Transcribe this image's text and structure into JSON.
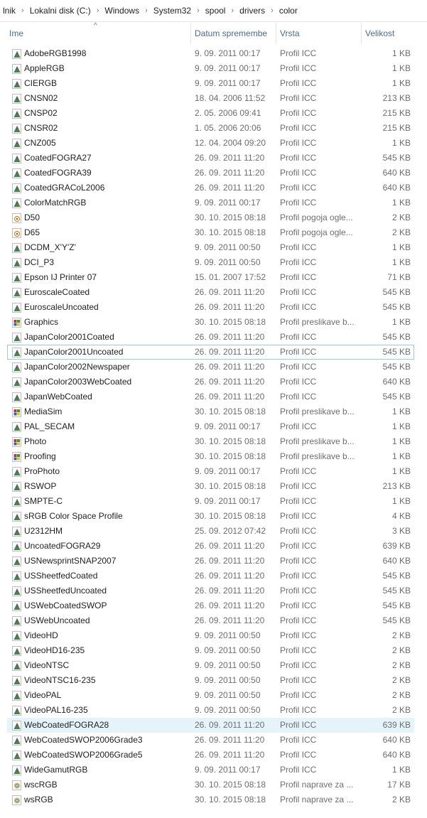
{
  "breadcrumb": [
    "lnik",
    "Lokalni disk (C:)",
    "Windows",
    "System32",
    "spool",
    "drivers",
    "color"
  ],
  "breadcrumb_separator": "›",
  "columns": {
    "name": "Ime",
    "date": "Datum spremembe",
    "type": "Vrsta",
    "size": "Velikost"
  },
  "sort_indicator": "^",
  "files": [
    {
      "name": "AdobeRGB1998",
      "date": "9. 09. 2011 00:17",
      "type": "Profil ICC",
      "size": "1 KB",
      "icon": "icc-profile-icon"
    },
    {
      "name": "AppleRGB",
      "date": "9. 09. 2011 00:17",
      "type": "Profil ICC",
      "size": "1 KB",
      "icon": "icc-profile-icon"
    },
    {
      "name": "CIERGB",
      "date": "9. 09. 2011 00:17",
      "type": "Profil ICC",
      "size": "1 KB",
      "icon": "icc-profile-icon"
    },
    {
      "name": "CNSN02",
      "date": "18. 04. 2006 11:52",
      "type": "Profil ICC",
      "size": "213 KB",
      "icon": "icc-profile-icon"
    },
    {
      "name": "CNSP02",
      "date": "2. 05. 2006 09:41",
      "type": "Profil ICC",
      "size": "215 KB",
      "icon": "icc-profile-icon"
    },
    {
      "name": "CNSR02",
      "date": "1. 05. 2006 20:06",
      "type": "Profil ICC",
      "size": "215 KB",
      "icon": "icc-profile-icon"
    },
    {
      "name": "CNZ005",
      "date": "12. 04. 2004 09:20",
      "type": "Profil ICC",
      "size": "1 KB",
      "icon": "icc-profile-icon"
    },
    {
      "name": "CoatedFOGRA27",
      "date": "26. 09. 2011 11:20",
      "type": "Profil ICC",
      "size": "545 KB",
      "icon": "icc-profile-icon"
    },
    {
      "name": "CoatedFOGRA39",
      "date": "26. 09. 2011 11:20",
      "type": "Profil ICC",
      "size": "640 KB",
      "icon": "icc-profile-icon"
    },
    {
      "name": "CoatedGRACoL2006",
      "date": "26. 09. 2011 11:20",
      "type": "Profil ICC",
      "size": "640 KB",
      "icon": "icc-profile-icon"
    },
    {
      "name": "ColorMatchRGB",
      "date": "9. 09. 2011 00:17",
      "type": "Profil ICC",
      "size": "1 KB",
      "icon": "icc-profile-icon"
    },
    {
      "name": "D50",
      "date": "30. 10. 2015 08:18",
      "type": "Profil pogoja ogle...",
      "size": "2 KB",
      "icon": "viewing-condition-icon"
    },
    {
      "name": "D65",
      "date": "30. 10. 2015 08:18",
      "type": "Profil pogoja ogle...",
      "size": "2 KB",
      "icon": "viewing-condition-icon"
    },
    {
      "name": "DCDM_X'Y'Z'",
      "date": "9. 09. 2011 00:50",
      "type": "Profil ICC",
      "size": "1 KB",
      "icon": "icc-profile-icon"
    },
    {
      "name": "DCI_P3",
      "date": "9. 09. 2011 00:50",
      "type": "Profil ICC",
      "size": "1 KB",
      "icon": "icc-profile-icon"
    },
    {
      "name": "Epson IJ Printer 07",
      "date": "15. 01. 2007 17:52",
      "type": "Profil ICC",
      "size": "71 KB",
      "icon": "icc-profile-icon"
    },
    {
      "name": "EuroscaleCoated",
      "date": "26. 09. 2011 11:20",
      "type": "Profil ICC",
      "size": "545 KB",
      "icon": "icc-profile-icon"
    },
    {
      "name": "EuroscaleUncoated",
      "date": "26. 09. 2011 11:20",
      "type": "Profil ICC",
      "size": "545 KB",
      "icon": "icc-profile-icon"
    },
    {
      "name": "Graphics",
      "date": "30. 10. 2015 08:18",
      "type": "Profil preslikave b...",
      "size": "1 KB",
      "icon": "gamut-map-icon"
    },
    {
      "name": "JapanColor2001Coated",
      "date": "26. 09. 2011 11:20",
      "type": "Profil ICC",
      "size": "545 KB",
      "icon": "icc-profile-icon"
    },
    {
      "name": "JapanColor2001Uncoated",
      "date": "26. 09. 2011 11:20",
      "type": "Profil ICC",
      "size": "545 KB",
      "icon": "icc-profile-icon"
    },
    {
      "name": "JapanColor2002Newspaper",
      "date": "26. 09. 2011 11:20",
      "type": "Profil ICC",
      "size": "545 KB",
      "icon": "icc-profile-icon"
    },
    {
      "name": "JapanColor2003WebCoated",
      "date": "26. 09. 2011 11:20",
      "type": "Profil ICC",
      "size": "640 KB",
      "icon": "icc-profile-icon"
    },
    {
      "name": "JapanWebCoated",
      "date": "26. 09. 2011 11:20",
      "type": "Profil ICC",
      "size": "545 KB",
      "icon": "icc-profile-icon"
    },
    {
      "name": "MediaSim",
      "date": "30. 10. 2015 08:18",
      "type": "Profil preslikave b...",
      "size": "1 KB",
      "icon": "gamut-map-icon"
    },
    {
      "name": "PAL_SECAM",
      "date": "9. 09. 2011 00:17",
      "type": "Profil ICC",
      "size": "1 KB",
      "icon": "icc-profile-icon"
    },
    {
      "name": "Photo",
      "date": "30. 10. 2015 08:18",
      "type": "Profil preslikave b...",
      "size": "1 KB",
      "icon": "gamut-map-icon"
    },
    {
      "name": "Proofing",
      "date": "30. 10. 2015 08:18",
      "type": "Profil preslikave b...",
      "size": "1 KB",
      "icon": "gamut-map-icon"
    },
    {
      "name": "ProPhoto",
      "date": "9. 09. 2011 00:17",
      "type": "Profil ICC",
      "size": "1 KB",
      "icon": "icc-profile-icon"
    },
    {
      "name": "RSWOP",
      "date": "30. 10. 2015 08:18",
      "type": "Profil ICC",
      "size": "213 KB",
      "icon": "icc-profile-icon"
    },
    {
      "name": "SMPTE-C",
      "date": "9. 09. 2011 00:17",
      "type": "Profil ICC",
      "size": "1 KB",
      "icon": "icc-profile-icon"
    },
    {
      "name": "sRGB Color Space Profile",
      "date": "30. 10. 2015 08:18",
      "type": "Profil ICC",
      "size": "4 KB",
      "icon": "icc-profile-icon"
    },
    {
      "name": "U2312HM",
      "date": "25. 09. 2012 07:42",
      "type": "Profil ICC",
      "size": "3 KB",
      "icon": "icc-profile-icon"
    },
    {
      "name": "UncoatedFOGRA29",
      "date": "26. 09. 2011 11:20",
      "type": "Profil ICC",
      "size": "639 KB",
      "icon": "icc-profile-icon"
    },
    {
      "name": "USNewsprintSNAP2007",
      "date": "26. 09. 2011 11:20",
      "type": "Profil ICC",
      "size": "640 KB",
      "icon": "icc-profile-icon"
    },
    {
      "name": "USSheetfedCoated",
      "date": "26. 09. 2011 11:20",
      "type": "Profil ICC",
      "size": "545 KB",
      "icon": "icc-profile-icon"
    },
    {
      "name": "USSheetfedUncoated",
      "date": "26. 09. 2011 11:20",
      "type": "Profil ICC",
      "size": "545 KB",
      "icon": "icc-profile-icon"
    },
    {
      "name": "USWebCoatedSWOP",
      "date": "26. 09. 2011 11:20",
      "type": "Profil ICC",
      "size": "545 KB",
      "icon": "icc-profile-icon"
    },
    {
      "name": "USWebUncoated",
      "date": "26. 09. 2011 11:20",
      "type": "Profil ICC",
      "size": "545 KB",
      "icon": "icc-profile-icon"
    },
    {
      "name": "VideoHD",
      "date": "9. 09. 2011 00:50",
      "type": "Profil ICC",
      "size": "2 KB",
      "icon": "icc-profile-icon"
    },
    {
      "name": "VideoHD16-235",
      "date": "9. 09. 2011 00:50",
      "type": "Profil ICC",
      "size": "2 KB",
      "icon": "icc-profile-icon"
    },
    {
      "name": "VideoNTSC",
      "date": "9. 09. 2011 00:50",
      "type": "Profil ICC",
      "size": "2 KB",
      "icon": "icc-profile-icon"
    },
    {
      "name": "VideoNTSC16-235",
      "date": "9. 09. 2011 00:50",
      "type": "Profil ICC",
      "size": "2 KB",
      "icon": "icc-profile-icon"
    },
    {
      "name": "VideoPAL",
      "date": "9. 09. 2011 00:50",
      "type": "Profil ICC",
      "size": "2 KB",
      "icon": "icc-profile-icon"
    },
    {
      "name": "VideoPAL16-235",
      "date": "9. 09. 2011 00:50",
      "type": "Profil ICC",
      "size": "2 KB",
      "icon": "icc-profile-icon"
    },
    {
      "name": "WebCoatedFOGRA28",
      "date": "26. 09. 2011 11:20",
      "type": "Profil ICC",
      "size": "639 KB",
      "icon": "icc-profile-icon"
    },
    {
      "name": "WebCoatedSWOP2006Grade3",
      "date": "26. 09. 2011 11:20",
      "type": "Profil ICC",
      "size": "640 KB",
      "icon": "icc-profile-icon"
    },
    {
      "name": "WebCoatedSWOP2006Grade5",
      "date": "26. 09. 2011 11:20",
      "type": "Profil ICC",
      "size": "640 KB",
      "icon": "icc-profile-icon"
    },
    {
      "name": "WideGamutRGB",
      "date": "9. 09. 2011 00:17",
      "type": "Profil ICC",
      "size": "1 KB",
      "icon": "icc-profile-icon"
    },
    {
      "name": "wscRGB",
      "date": "30. 10. 2015 08:18",
      "type": "Profil naprave za ...",
      "size": "17 KB",
      "icon": "device-model-icon"
    },
    {
      "name": "wsRGB",
      "date": "30. 10. 2015 08:18",
      "type": "Profil naprave za ...",
      "size": "2 KB",
      "icon": "device-model-icon"
    }
  ],
  "focused_row": 20,
  "hovered_row": 45,
  "colors": {
    "header_text": "#4d6a8a",
    "row_hover": "#e5f3fb",
    "focus_border": "#99c9ea",
    "secondary_text": "#6d6d6d"
  }
}
